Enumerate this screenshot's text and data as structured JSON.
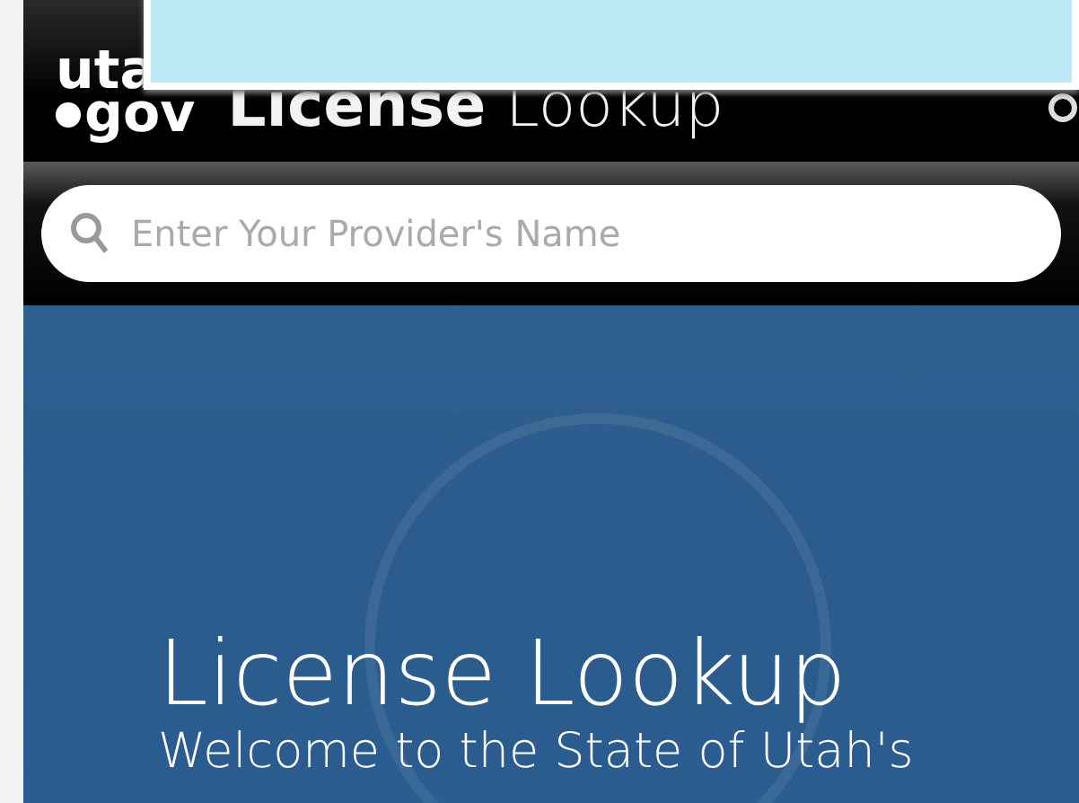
{
  "header": {
    "logo": {
      "top": "uta",
      "bottom": "gov"
    },
    "title": "**License** Lookup"
  },
  "search": {
    "placeholder": "Enter Your Provider's Name"
  },
  "hero": {
    "title": "License Lookup",
    "subtitle": "Welcome to the State of Utah's"
  }
}
